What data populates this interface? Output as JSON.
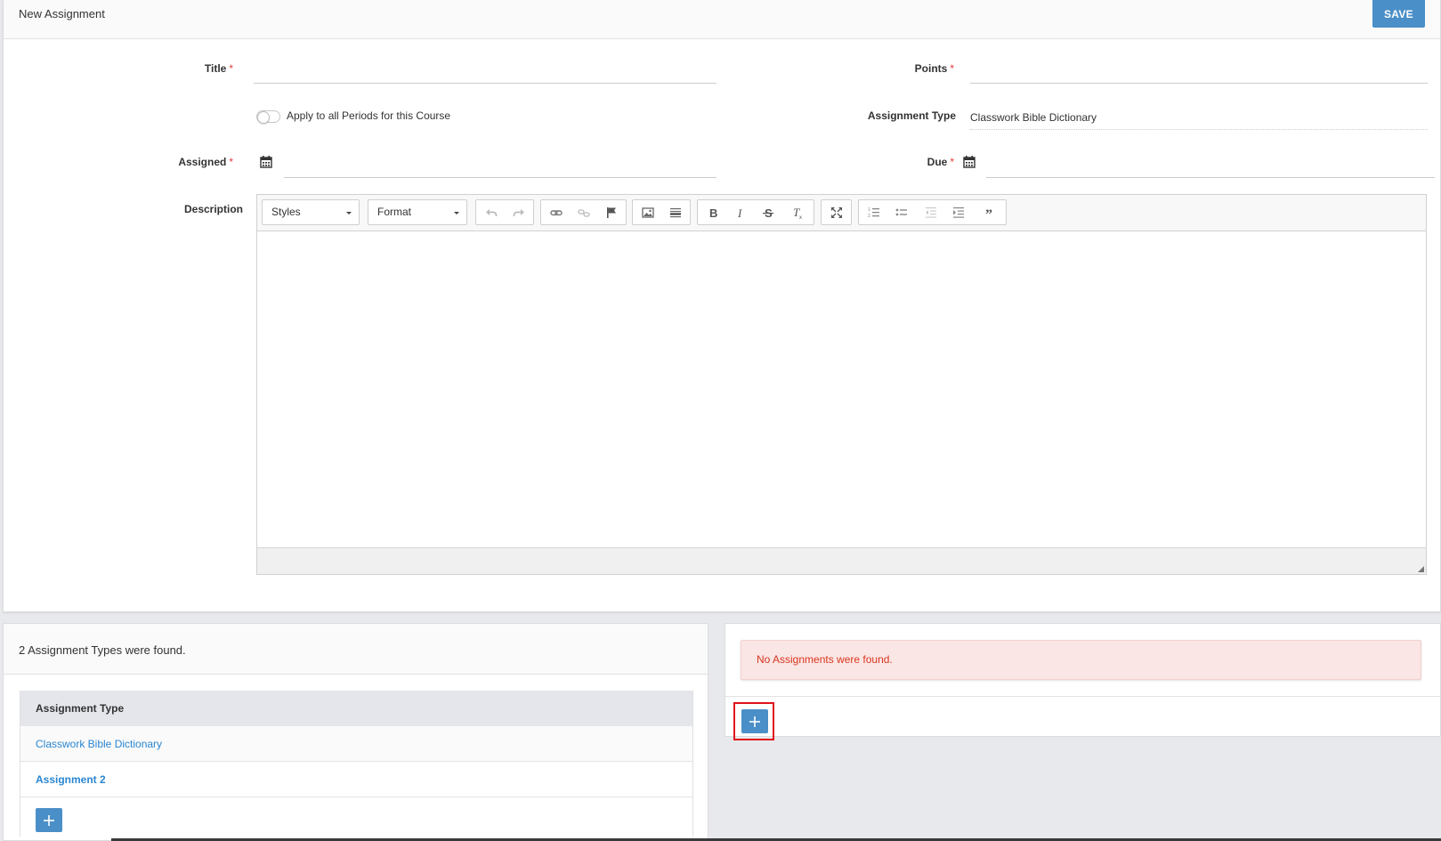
{
  "header": {
    "title": "New Assignment",
    "save_label": "SAVE"
  },
  "form": {
    "title_label": "Title",
    "points_label": "Points",
    "required_mark": "*",
    "apply_all_label": "Apply to all Periods for this Course",
    "assignment_type_label": "Assignment Type",
    "assignment_type_value": "Classwork Bible Dictionary",
    "assigned_label": "Assigned",
    "due_label": "Due",
    "description_label": "Description",
    "title_value": "",
    "points_value": "",
    "assigned_value": "",
    "due_value": ""
  },
  "editor": {
    "styles_label": "Styles",
    "format_label": "Format",
    "toolbar_icons": [
      "undo-icon",
      "redo-icon",
      "link-icon",
      "unlink-icon",
      "anchor-flag-icon",
      "image-icon",
      "horizontal-line-icon",
      "bold-icon",
      "italic-icon",
      "strikethrough-icon",
      "remove-format-icon",
      "maximize-icon",
      "numbered-list-icon",
      "bulleted-list-icon",
      "outdent-icon",
      "indent-icon",
      "blockquote-icon"
    ]
  },
  "types_panel": {
    "found_text": "2 Assignment Types were found.",
    "column_header": "Assignment Type",
    "rows": [
      "Classwork Bible Dictionary",
      "Assignment 2"
    ],
    "add_icon": "plus-icon"
  },
  "assignments_panel": {
    "empty_message": "No Assignments were found.",
    "add_icon": "plus-icon"
  },
  "colors": {
    "accent": "#4a8fc7",
    "link": "#2a86d1",
    "required": "#e23b3b",
    "alert_bg": "#fae6e4",
    "alert_text": "#d9351f",
    "highlight": "#e0111b"
  }
}
